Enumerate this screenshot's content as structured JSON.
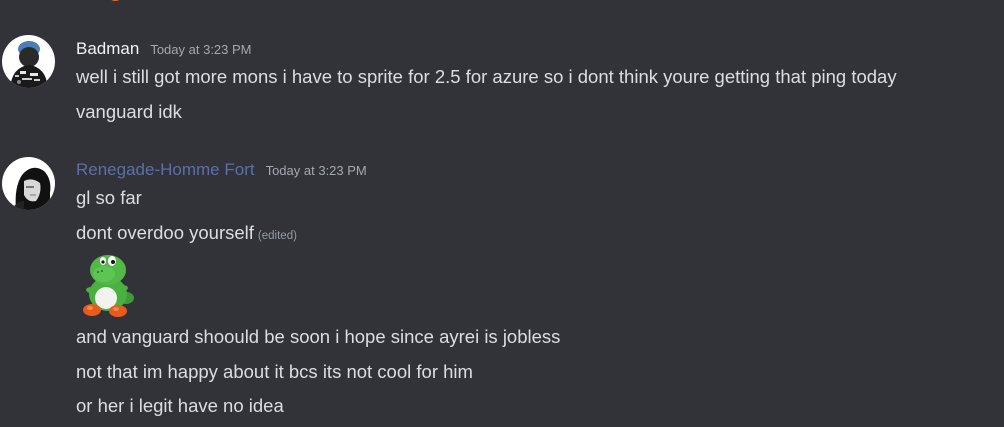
{
  "messages": [
    {
      "author": "Badman",
      "timestamp": "Today at 3:23 PM",
      "lines": [
        "well i still got more mons i have to sprite for 2.5 for azure so i dont think youre getting that ping today",
        "vanguard idk"
      ]
    },
    {
      "author": "Renegade-Homme Fort",
      "timestamp": "Today at 3:23 PM",
      "lines": [
        "gl so far",
        "dont overdoo yourself",
        "and vanguard shoould be soon i hope since ayrei is jobless",
        "not that im happy about it bcs its not cool for him",
        "or her i legit have no idea"
      ],
      "edited_label": "(edited)",
      "sticker": "green-dinosaur-sticker"
    }
  ],
  "colors": {
    "background": "#313338",
    "text": "#dbdee1",
    "timestamp": "#a4a8b0",
    "renegade_name": "#5d6ea8"
  }
}
